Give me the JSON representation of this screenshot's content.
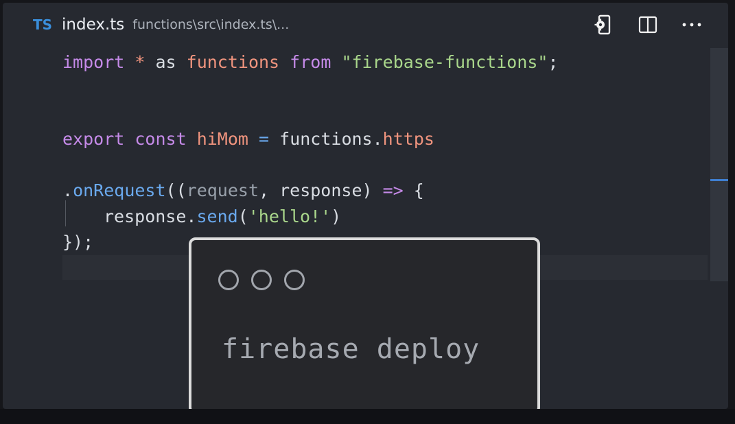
{
  "tab": {
    "language_badge": "TS",
    "file_name": "index.ts",
    "breadcrumb": "functions\\src\\index.ts\\..."
  },
  "tab_actions": [
    {
      "icon": "open-preview-icon"
    },
    {
      "icon": "split-editor-icon"
    },
    {
      "icon": "more-actions-icon"
    }
  ],
  "code": {
    "line1": {
      "t1": "import",
      "t2": " * ",
      "t3": "as",
      "t4": " ",
      "t5": "functions",
      "t6": " ",
      "t7": "from",
      "t8": " ",
      "t9": "\"firebase-functions\"",
      "t10": ";"
    },
    "line2": {
      "t1": "export",
      "t2": " ",
      "t3": "const",
      "t4": " ",
      "t5": "hiMom",
      "t6": " ",
      "t7": "=",
      "t8": " functions.",
      "t9": "https"
    },
    "line3": {
      "t1": ".",
      "t2": "onRequest",
      "t3": "((",
      "t4": "request",
      "t5": ", response) ",
      "t6": "=>",
      "t7": " {"
    },
    "line4": {
      "t1": "response.",
      "t2": "send",
      "t3": "(",
      "t4": "'hello!'",
      "t5": ")"
    },
    "line5": {
      "t1": "});"
    }
  },
  "terminal": {
    "command": "firebase deploy"
  },
  "colors": {
    "keyword": "#c58ae8",
    "variable": "#f0947e",
    "function": "#6aa9ee",
    "string": "#a9d68b",
    "ts_badge": "#3a8fdc"
  }
}
